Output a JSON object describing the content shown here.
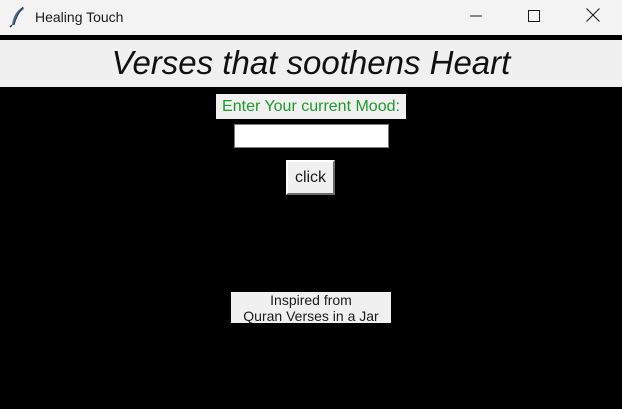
{
  "window": {
    "title": "Healing Touch",
    "icon": "feather-icon",
    "controls": [
      "minimize-icon",
      "maximize-icon",
      "close-icon"
    ]
  },
  "header": {
    "title": "Verses that soothens Heart"
  },
  "form": {
    "mood_label": "Enter Your current Mood:",
    "mood_value": "",
    "submit_label": "click"
  },
  "credit": {
    "line1": "Inspired from",
    "line2": "Quran Verses in a Jar"
  },
  "colors": {
    "background": "#000000",
    "label_green": "#1e9a2b",
    "panel": "#f0f0f0"
  }
}
